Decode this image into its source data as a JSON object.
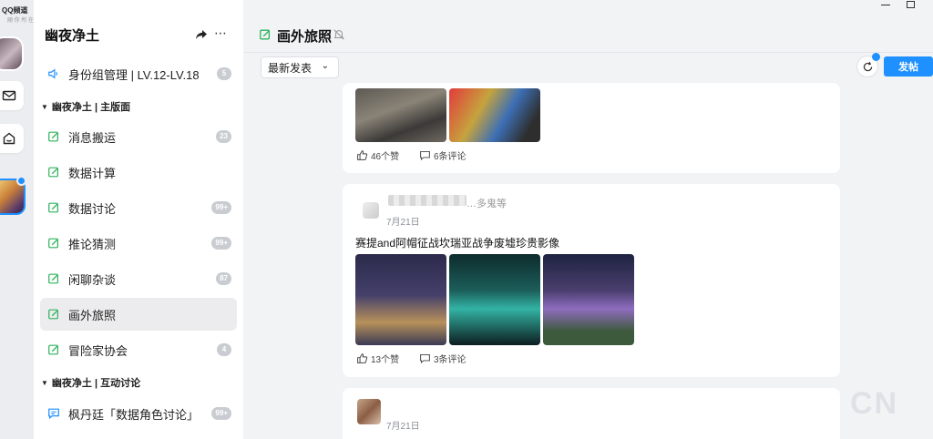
{
  "app": {
    "brand": "QQ频道",
    "brand_sub": "随 你 所 在"
  },
  "colors": {
    "accent": "#1e90ff",
    "badge": "#c9ccd1",
    "active_row": "#ececee",
    "channel_icon": "#2fb35d"
  },
  "sidebar": {
    "guild_name": "幽夜净土",
    "role_item": {
      "label": "身份组管理 | LV.12-LV.18",
      "badge": "5"
    },
    "groups": [
      {
        "label": "幽夜净土 | 主版面"
      },
      {
        "label": "幽夜净土 | 互动讨论"
      }
    ],
    "channels": [
      {
        "label": "消息搬运",
        "badge": "23"
      },
      {
        "label": "数据计算",
        "badge": ""
      },
      {
        "label": "数据讨论",
        "badge": "99+"
      },
      {
        "label": "推论猜测",
        "badge": "99+"
      },
      {
        "label": "闲聊杂谈",
        "badge": "87"
      },
      {
        "label": "画外旅照",
        "badge": ""
      },
      {
        "label": "冒险家协会",
        "badge": "4"
      }
    ],
    "discussion_channels": [
      {
        "label": "枫丹廷「数据角色讨论」",
        "badge": "99+"
      }
    ]
  },
  "main": {
    "channel_title": "画外旅照",
    "sort_label": "最新发表",
    "post_button": "发帖",
    "posts": [
      {
        "likes": "46个赞",
        "comments": "6条评论"
      },
      {
        "name_tail": "…多鬼等",
        "date": "7月21日",
        "text": "赛提and阿帽征战坎瑞亚战争废墟珍贵影像",
        "likes": "13个赞",
        "comments": "3条评论"
      },
      {
        "date": "7月21日"
      }
    ]
  },
  "watermark": "CN"
}
